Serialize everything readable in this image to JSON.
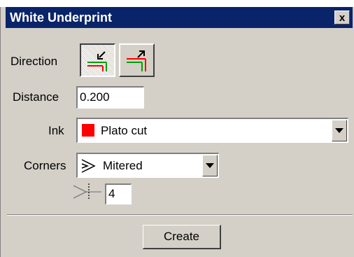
{
  "window": {
    "title": "White Underprint",
    "close_glyph": "x"
  },
  "direction": {
    "label": "Direction",
    "options": [
      {
        "icon": "inward-offset-arrow-icon",
        "pressed": true
      },
      {
        "icon": "outward-offset-arrow-icon",
        "pressed": false
      }
    ]
  },
  "distance": {
    "label": "Distance",
    "value": "0.200"
  },
  "ink": {
    "label": "Ink",
    "selected": "Plato cut",
    "swatch_color": "#ff0000"
  },
  "corners": {
    "label": "Corners",
    "selected": "Mitered",
    "icon": "mitered-corner-icon"
  },
  "miter_limit": {
    "icon": "miter-limit-icon",
    "value": "4"
  },
  "create_button": {
    "label": "Create"
  },
  "colors": {
    "titlebar": "#0a246a",
    "panel": "#d4d0c8",
    "accent_green": "#00a000",
    "accent_red": "#ff0000"
  }
}
